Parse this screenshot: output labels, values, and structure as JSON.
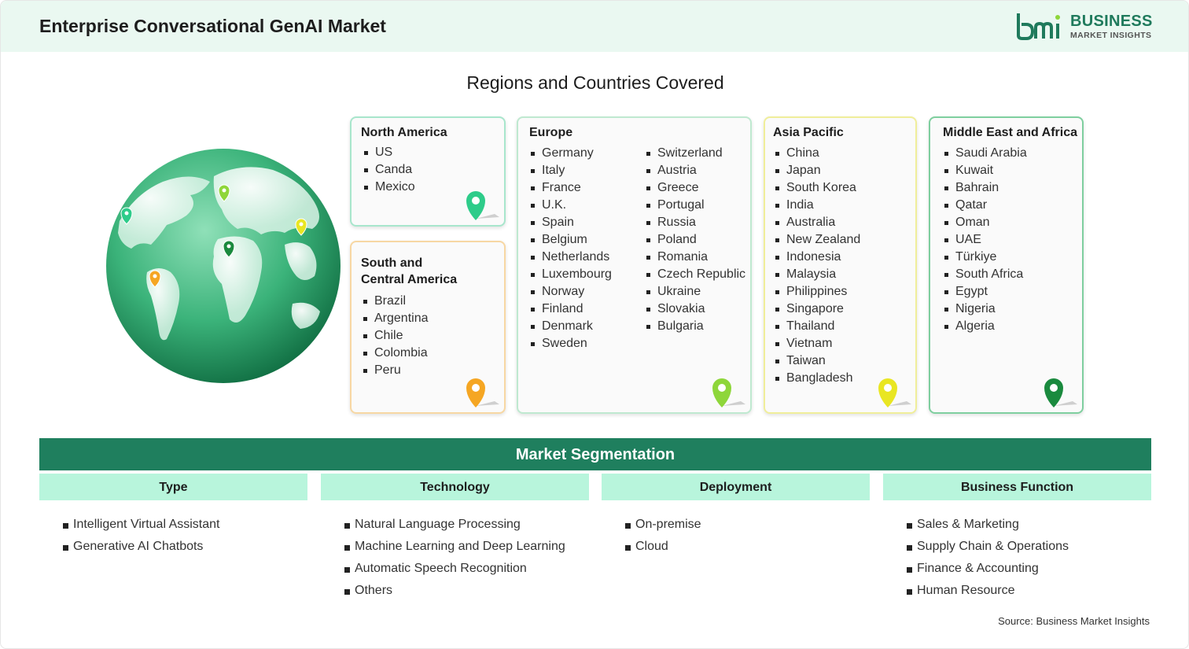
{
  "header": {
    "title": "Enterprise Conversational GenAI Market",
    "logo_line1": "BUSINESS",
    "logo_line2": "MARKET INSIGHTS"
  },
  "regions_title": "Regions and Countries Covered",
  "regions": {
    "north_america": {
      "title": "North America",
      "countries": [
        "US",
        "Canda",
        "Mexico"
      ],
      "pin_color": "#2ecc8a"
    },
    "south_america": {
      "title_line1": "South and",
      "title_line2": "Central America",
      "countries": [
        "Brazil",
        "Argentina",
        "Chile",
        "Colombia",
        "Peru"
      ],
      "pin_color": "#f5a623"
    },
    "europe": {
      "title": "Europe",
      "countries_col1": [
        "Germany",
        "Italy",
        "France",
        "U.K.",
        "Spain",
        "Belgium",
        "Netherlands",
        "Luxembourg",
        "Norway",
        "Finland",
        "Denmark",
        "Sweden"
      ],
      "countries_col2": [
        "Switzerland",
        "Austria",
        "Greece",
        "Portugal",
        "Russia",
        "Poland",
        "Romania",
        "Czech Republic",
        "Ukraine",
        "Slovakia",
        "Bulgaria"
      ],
      "pin_color": "#8ed63a"
    },
    "asia_pacific": {
      "title": "Asia Pacific",
      "countries": [
        "China",
        "Japan",
        "South Korea",
        "India",
        "Australia",
        "New Zealand",
        "Indonesia",
        "Malaysia",
        "Philippines",
        "Singapore",
        "Thailand",
        "Vietnam",
        "Taiwan",
        "Bangladesh"
      ],
      "pin_color": "#e9e622"
    },
    "mea": {
      "title": "Middle East and Africa",
      "countries": [
        "Saudi Arabia",
        "Kuwait",
        "Bahrain",
        "Qatar",
        "Oman",
        "UAE",
        "Türkiye",
        "South Africa",
        "Egypt",
        "Nigeria",
        "Algeria"
      ],
      "pin_color": "#1a8a3e"
    }
  },
  "segmentation": {
    "title": "Market Segmentation",
    "columns": [
      {
        "head": "Type",
        "items": [
          "Intelligent Virtual Assistant",
          "Generative AI Chatbots"
        ]
      },
      {
        "head": "Technology",
        "items": [
          "Natural Language Processing",
          "Machine Learning and Deep Learning",
          "Automatic Speech Recognition",
          "Others"
        ]
      },
      {
        "head": "Deployment",
        "items": [
          "On-premise",
          "Cloud"
        ]
      },
      {
        "head": "Business Function",
        "items": [
          "Sales & Marketing",
          "Supply Chain & Operations",
          "Finance & Accounting",
          "Human Resource"
        ]
      }
    ]
  },
  "source": "Source: Business Market Insights",
  "colors": {
    "accent": "#1f7f5e",
    "header_bg": "#eaf8f1",
    "seg_head_bg": "#b8f5dc"
  }
}
